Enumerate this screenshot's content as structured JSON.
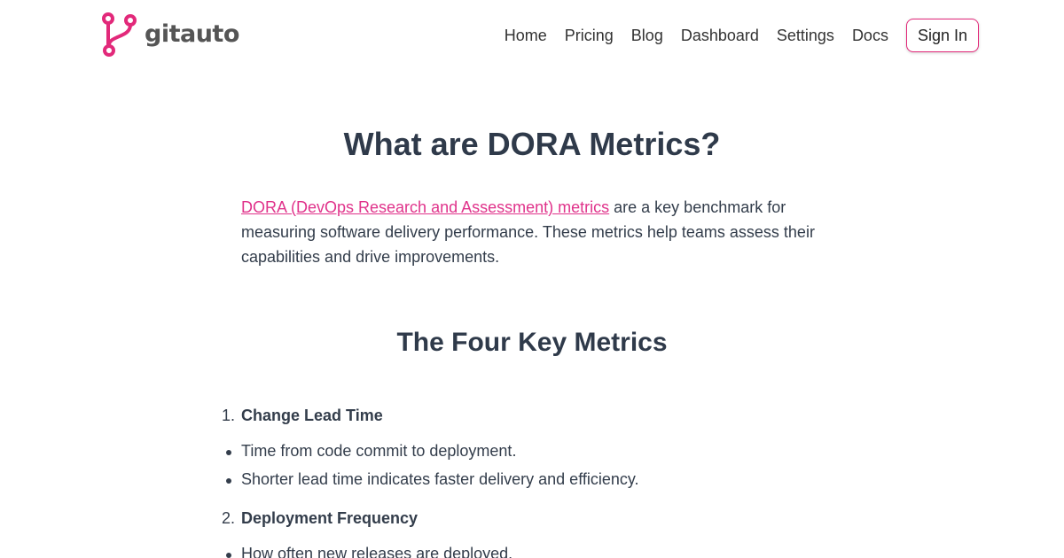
{
  "brand": {
    "name": "gitauto",
    "accent_color": "#e2297a",
    "logo_icon": "git-branch-icon"
  },
  "nav": {
    "items": [
      {
        "label": "Home"
      },
      {
        "label": "Pricing"
      },
      {
        "label": "Blog"
      },
      {
        "label": "Dashboard"
      },
      {
        "label": "Settings"
      },
      {
        "label": "Docs"
      }
    ],
    "sign_in_label": "Sign In"
  },
  "article": {
    "title": "What are DORA Metrics?",
    "intro_link": "DORA (DevOps Research and Assessment) metrics",
    "intro_text": " are a key benchmark for measuring software delivery performance. These metrics help teams assess their capabilities and drive improvements.",
    "section_title": "The Four Key Metrics",
    "metrics": [
      {
        "number": "1.",
        "title": "Change Lead Time",
        "bullets": [
          "Time from code commit to deployment.",
          "Shorter lead time indicates faster delivery and efficiency."
        ]
      },
      {
        "number": "2.",
        "title": "Deployment Frequency",
        "bullets": [
          "How often new releases are deployed."
        ]
      }
    ]
  }
}
